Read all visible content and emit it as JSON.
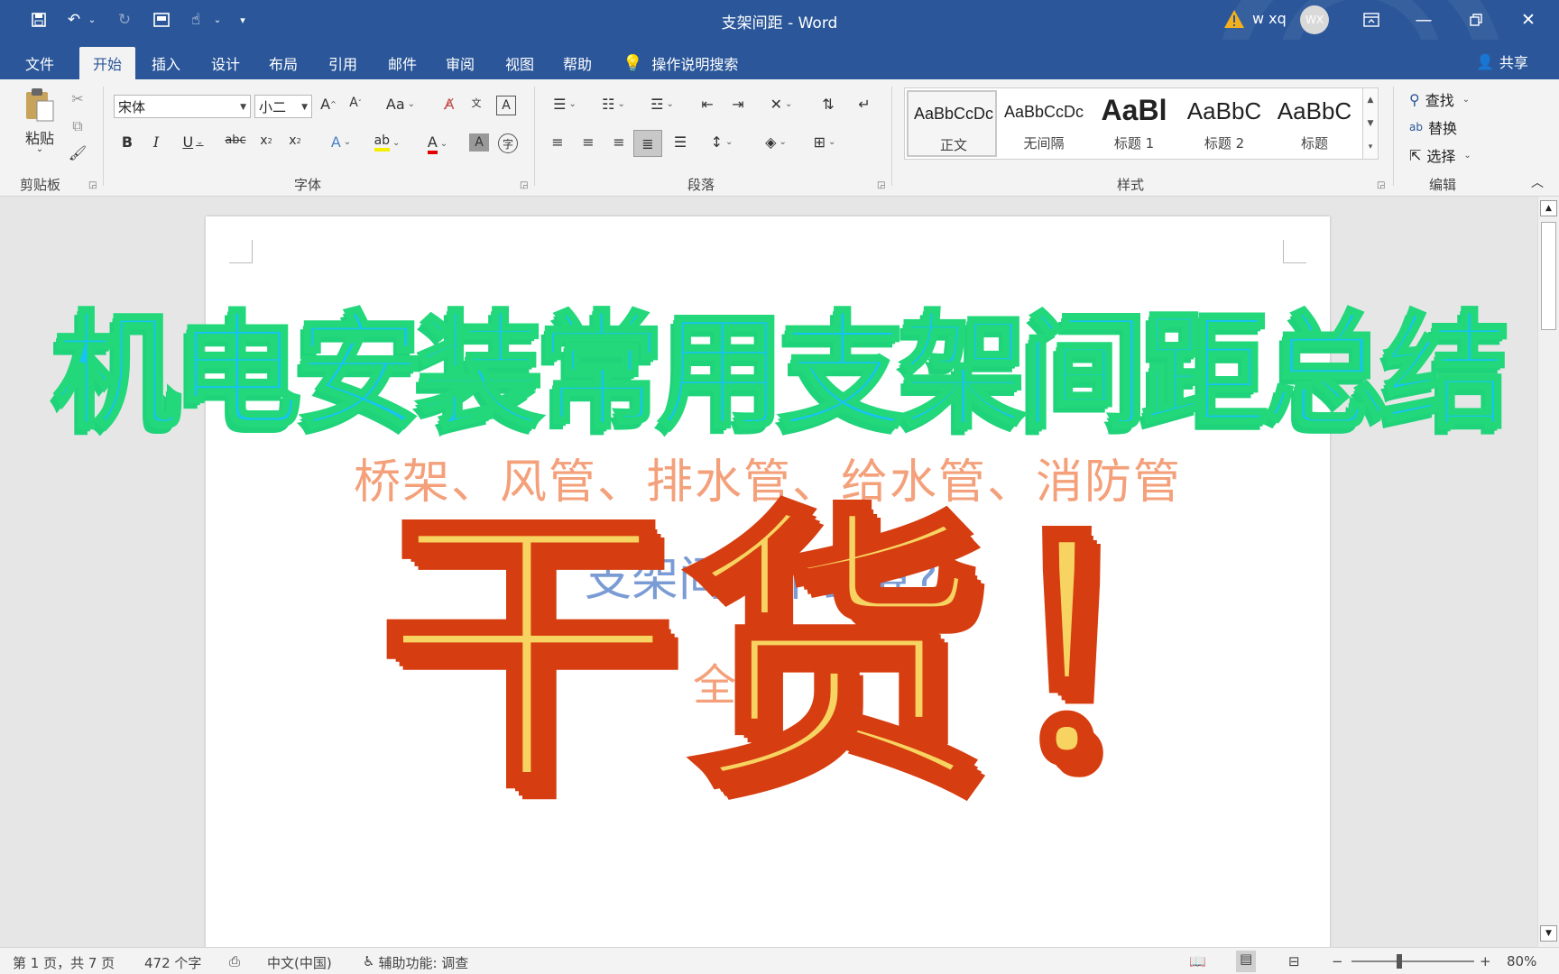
{
  "titlebar": {
    "document_title": "支架间距 - Word",
    "user_name": "w xq",
    "avatar_initials": "WX",
    "quick_access": [
      "save-icon",
      "undo-icon",
      "redo-icon",
      "print-preview-icon",
      "touch-mode-icon",
      "customize-icon"
    ],
    "window_controls": [
      "ribbon-display-options-icon",
      "minimize-icon",
      "restore-icon",
      "close-icon"
    ]
  },
  "tabs": {
    "items": [
      "文件",
      "开始",
      "插入",
      "设计",
      "布局",
      "引用",
      "邮件",
      "审阅",
      "视图",
      "帮助"
    ],
    "active": "开始",
    "tell_me": "操作说明搜索",
    "share": "共享"
  },
  "ribbon": {
    "clipboard": {
      "label": "剪贴板",
      "paste": "粘贴"
    },
    "font": {
      "label": "字体",
      "font_name": "宋体",
      "font_size": "小二"
    },
    "paragraph": {
      "label": "段落"
    },
    "styles": {
      "label": "样式",
      "items": [
        {
          "sample": "AaBbCcDc",
          "name": "正文"
        },
        {
          "sample": "AaBbCcDc",
          "name": "无间隔"
        },
        {
          "sample": "AaBl",
          "name": "标题 1"
        },
        {
          "sample": "AaBbC",
          "name": "标题 2"
        },
        {
          "sample": "AaBbC",
          "name": "标题"
        }
      ]
    },
    "editing": {
      "label": "编辑",
      "find": "查找",
      "replace": "替换",
      "select": "选择"
    }
  },
  "document": {
    "subtitle": "桥架、风管、排水管、给水管、消防管",
    "question": "支架间距不会算?",
    "full": "全"
  },
  "overlay": {
    "headline": "机电安装常用支架间距总结",
    "dry_goods": "干货！"
  },
  "statusbar": {
    "page": "第 1 页，共 7 页",
    "words": "472 个字",
    "language": "中文(中国)",
    "accessibility": "辅助功能: 调查",
    "zoom": "80%"
  }
}
